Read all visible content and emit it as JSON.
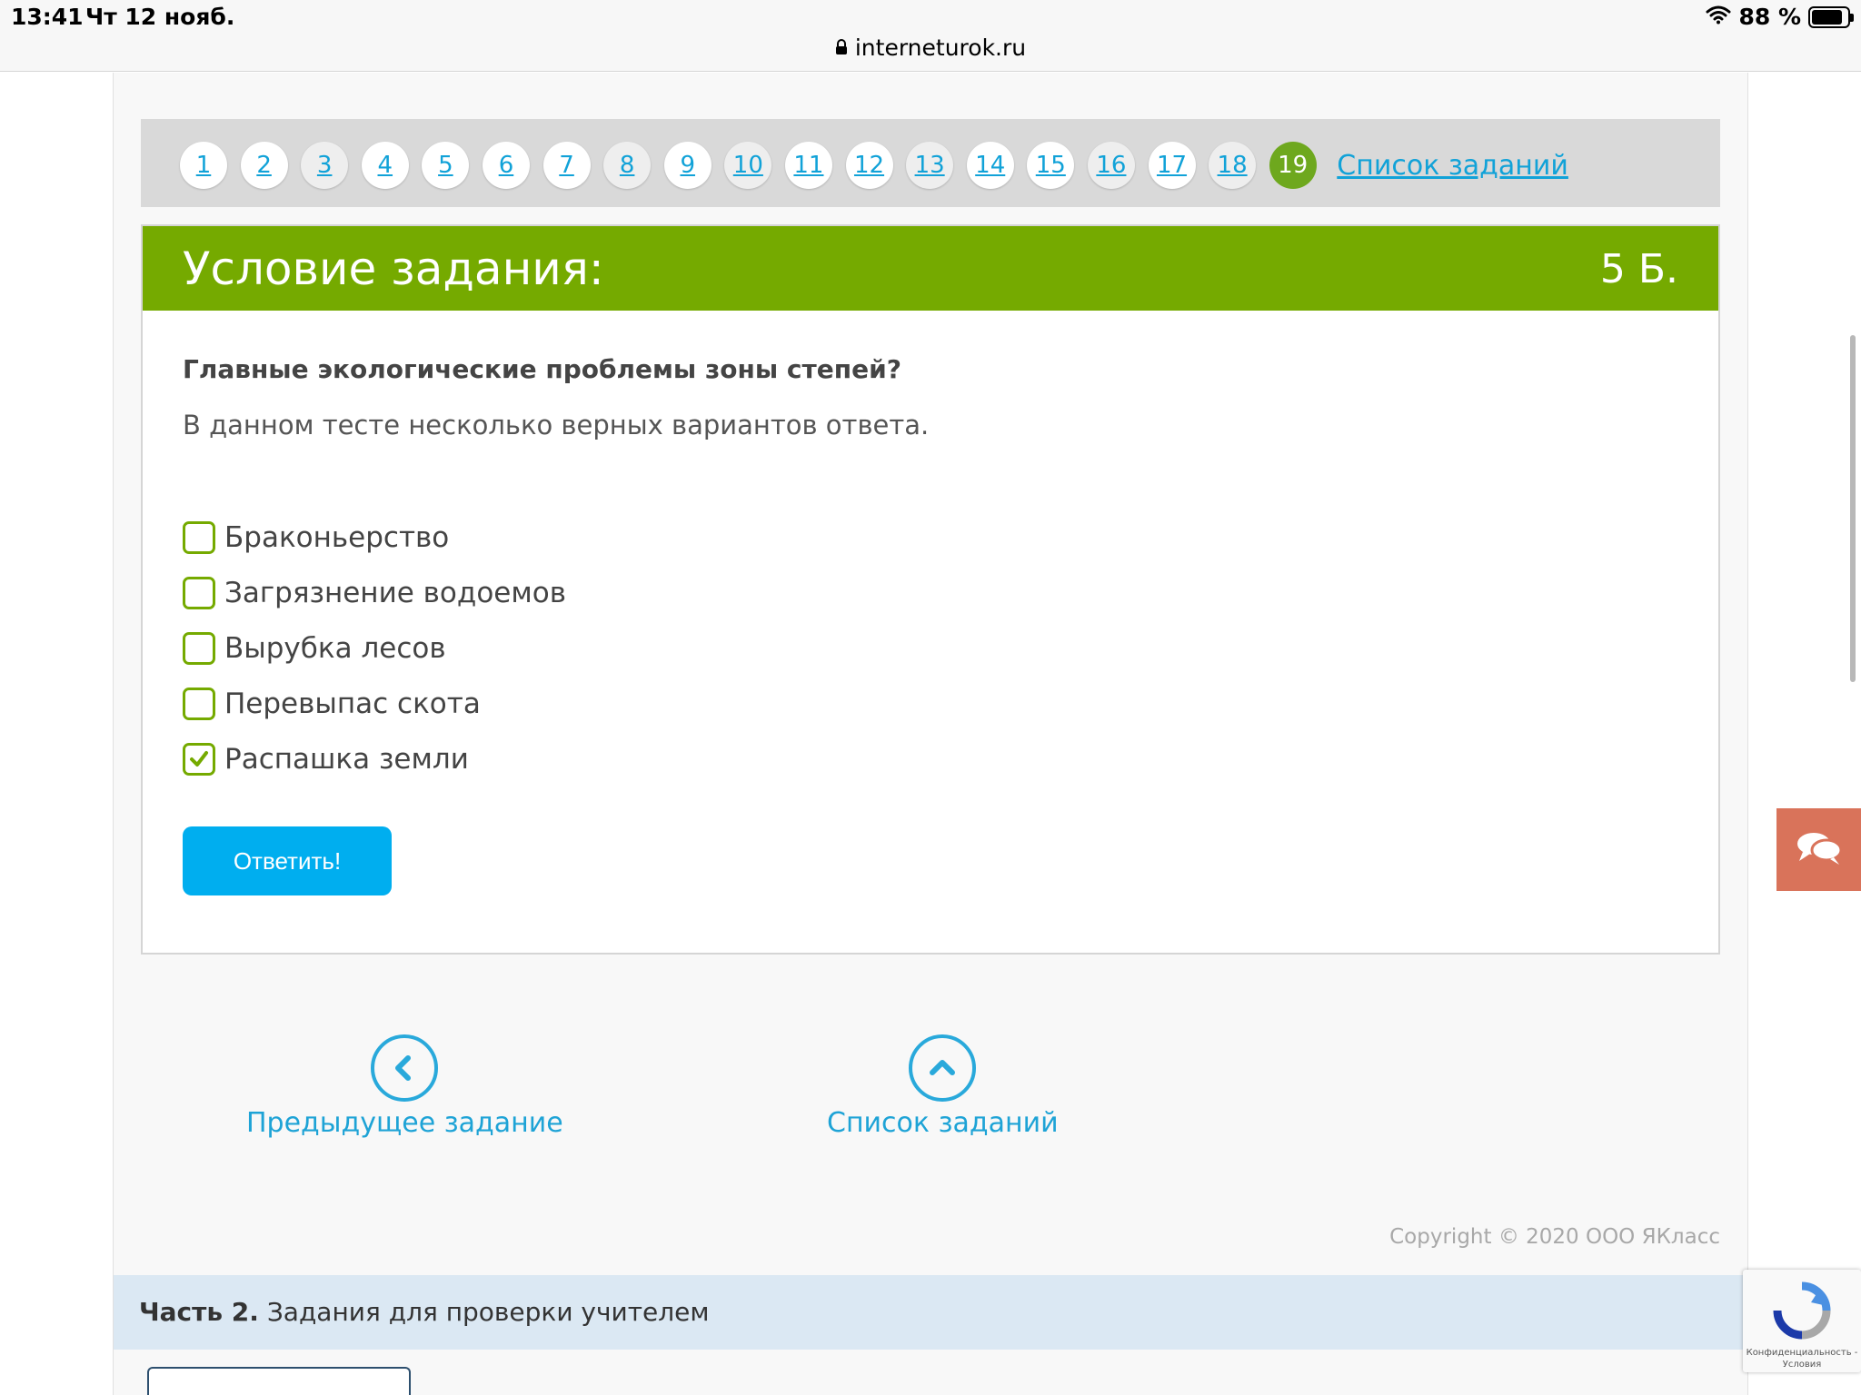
{
  "status_bar": {
    "time": "13:41",
    "date": "Чт 12 нояб.",
    "battery": "88 %",
    "battery_level": 0.88,
    "url": "interneturok.ru"
  },
  "pager": {
    "items": [
      {
        "label": "1"
      },
      {
        "label": "2"
      },
      {
        "label": "3"
      },
      {
        "label": "4"
      },
      {
        "label": "5"
      },
      {
        "label": "6"
      },
      {
        "label": "7"
      },
      {
        "label": "8"
      },
      {
        "label": "9"
      },
      {
        "label": "10"
      },
      {
        "label": "11"
      },
      {
        "label": "12"
      },
      {
        "label": "13"
      },
      {
        "label": "14"
      },
      {
        "label": "15"
      },
      {
        "label": "16"
      },
      {
        "label": "17"
      },
      {
        "label": "18"
      },
      {
        "label": "19"
      }
    ],
    "active": "19",
    "list_link": "Список заданий"
  },
  "task": {
    "header_title": "Условие задания:",
    "points": "5 Б.",
    "question": "Главные экологические проблемы зоны степей?",
    "note": "В данном тесте несколько верных вариантов ответа.",
    "options": [
      {
        "label": "Браконьерство",
        "checked": false
      },
      {
        "label": "Загрязнение водоемов",
        "checked": false
      },
      {
        "label": "Вырубка лесов",
        "checked": false
      },
      {
        "label": "Перевыпас скота",
        "checked": false
      },
      {
        "label": "Распашка земли",
        "checked": true
      }
    ],
    "answer_button": "Ответить!"
  },
  "navigation": {
    "prev_label": "Предыдущее задание",
    "list_label": "Список заданий"
  },
  "copyright": "Copyright © 2020 ООО ЯКласс",
  "part2": {
    "bold": "Часть 2.",
    "text": "Задания для проверки учителем"
  },
  "recaptcha": {
    "text_line1": "Конфиденциальность -",
    "text_line2": "Условия"
  },
  "colors": {
    "accent_green": "#75aa00",
    "link_blue": "#11a2d8",
    "button_blue": "#00aeef",
    "chat_orange": "#d9735a"
  }
}
